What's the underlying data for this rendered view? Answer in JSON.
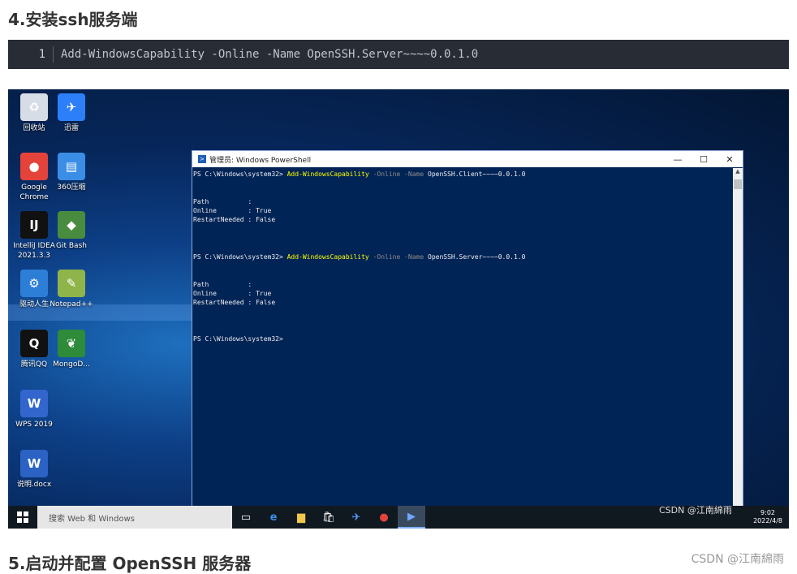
{
  "article": {
    "heading4": "4.安装ssh服务端",
    "code_line_no": "1",
    "code_text": "Add-WindowsCapability -Online -Name OpenSSH.Server~~~~0.0.1.0",
    "heading5": "5.启动并配置 OpenSSH 服务器",
    "footer_credit": "CSDN @江南綿雨"
  },
  "desktop_icons": [
    {
      "label": "回收站",
      "icon": "recycle-bin-icon",
      "color": "#d7dde6",
      "glyph": "♻"
    },
    {
      "label": "迅雷",
      "icon": "thunder-icon",
      "color": "#2d7ff9",
      "glyph": "✈"
    },
    {
      "label": "Google Chrome",
      "icon": "chrome-icon",
      "color": "#e4433a",
      "glyph": "●"
    },
    {
      "label": "360压缩",
      "icon": "zip-icon",
      "color": "#3a8ee6",
      "glyph": "▤"
    },
    {
      "label": "IntelliJ IDEA 2021.3.3",
      "icon": "intellij-icon",
      "color": "#111111",
      "glyph": "IJ"
    },
    {
      "label": "Git Bash",
      "icon": "git-icon",
      "color": "#4a8c3f",
      "glyph": "◆"
    },
    {
      "label": "驱动人生",
      "icon": "driver-icon",
      "color": "#2c7ed6",
      "glyph": "⚙"
    },
    {
      "label": "Notepad++",
      "icon": "notepad-icon",
      "color": "#8fb44a",
      "glyph": "✎"
    },
    {
      "label": "腾讯QQ",
      "icon": "qq-icon",
      "color": "#111111",
      "glyph": "Q"
    },
    {
      "label": "MongoD...",
      "icon": "mongodb-icon",
      "color": "#2e8b3a",
      "glyph": "❦"
    },
    {
      "label": "WPS 2019",
      "icon": "wps-icon",
      "color": "#3366cc",
      "glyph": "W"
    },
    {
      "label": "说明.docx",
      "icon": "docx-icon",
      "color": "#2b62c4",
      "glyph": "W"
    }
  ],
  "powershell": {
    "title": "管理员: Windows PowerShell",
    "prompt1": "PS C:\\Windows\\system32> ",
    "cmd1": "Add-WindowsCapability",
    "params1": " -Online -Name ",
    "arg1": "OpenSSH.Client~~~~0.0.1.0",
    "out1": "\n\n\nPath          :\nOnline        : True\nRestartNeeded : False\n\n\n\n",
    "prompt2": "PS C:\\Windows\\system32> ",
    "cmd2": "Add-WindowsCapability",
    "params2": " -Online -Name ",
    "arg2": "OpenSSH.Server~~~~0.0.1.0",
    "out2": "\n\n\nPath          :\nOnline        : True\nRestartNeeded : False\n\n\n\n",
    "prompt3": "PS C:\\Windows\\system32>"
  },
  "taskbar": {
    "search_placeholder": "搜索 Web 和 Windows",
    "time": "9:02",
    "date": "2022/4/8",
    "watermark": "CSDN @江南綿雨"
  }
}
